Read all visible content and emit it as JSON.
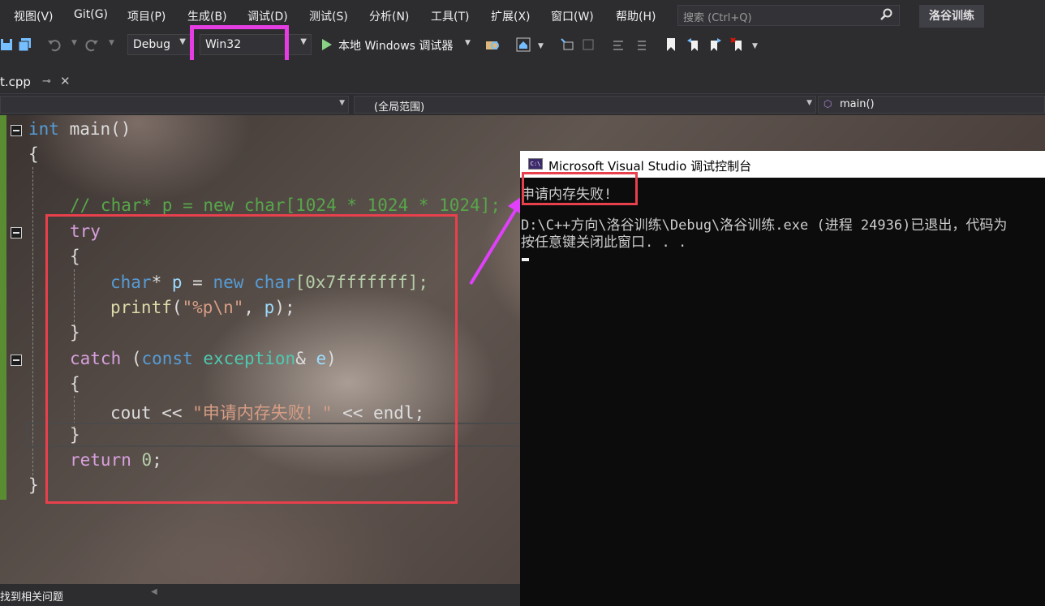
{
  "menu": {
    "items": [
      "视图(V)",
      "Git(G)",
      "项目(P)",
      "生成(B)",
      "调试(D)",
      "测试(S)",
      "分析(N)",
      "工具(T)",
      "扩展(X)",
      "窗口(W)",
      "帮助(H)"
    ],
    "search_placeholder": "搜索 (Ctrl+Q)",
    "app_title": "洛谷训练"
  },
  "toolbar": {
    "config": "Debug",
    "platform": "Win32",
    "debugger": "本地 Windows 调试器",
    "icons": [
      "save-icon",
      "save-all-icon",
      "undo-icon",
      "redo-icon",
      "start-debug-icon",
      "find-in-files-icon",
      "home-icon",
      "step-icon",
      "comment-icon",
      "uncomment-icon",
      "bookmark-icon",
      "prev-bookmark-icon",
      "next-bookmark-icon",
      "clear-bookmarks-icon"
    ]
  },
  "tab": {
    "file": "t.cpp"
  },
  "nav": {
    "scope": "(全局范围)",
    "member": "main()"
  },
  "code": {
    "l1": {
      "kw": "int",
      "rest": " main()"
    },
    "l2": "{",
    "l3": "// char* p = new char[1024 * 1024 * 1024];",
    "l4": "try",
    "l5": "{",
    "l6": {
      "kw1": "char",
      "p1": "* ",
      "v": "p",
      "p2": " = ",
      "kw2": "new",
      "sp": " ",
      "kw3": "char",
      "rest": "[0x7fffffff];"
    },
    "l7": {
      "fn": "printf",
      "p1": "(",
      "str": "\"%p\\n\"",
      "p2": ", ",
      "v": "p",
      "p3": ");"
    },
    "l8": "}",
    "l9": {
      "kw": "catch",
      "p1": " (",
      "kw2": "const",
      "sp": " ",
      "typ": "exception",
      "p2": "& ",
      "v": "e",
      "p3": ")"
    },
    "l10": "{",
    "l11": {
      "t1": "cout << ",
      "str": "\"申请内存失败！\"",
      "t2": " << endl;"
    },
    "l12": "}",
    "l13": {
      "kw": "return",
      "p1": " ",
      "num": "0",
      "p2": ";"
    },
    "l14": "}"
  },
  "console": {
    "title": "Microsoft Visual Studio 调试控制台",
    "lines": [
      "申请内存失败!",
      "",
      "D:\\C++方向\\洛谷训练\\Debug\\洛谷训练.exe (进程 24936)已退出，代码为",
      "按任意键关闭此窗口. . ."
    ]
  },
  "status": {
    "text": "找到相关问题"
  },
  "colors": {
    "highlight_magenta": "#e43de2",
    "annotation_red": "#e8404c",
    "arrow_magenta": "#e040fb",
    "vs_background": "#2d2d30"
  }
}
